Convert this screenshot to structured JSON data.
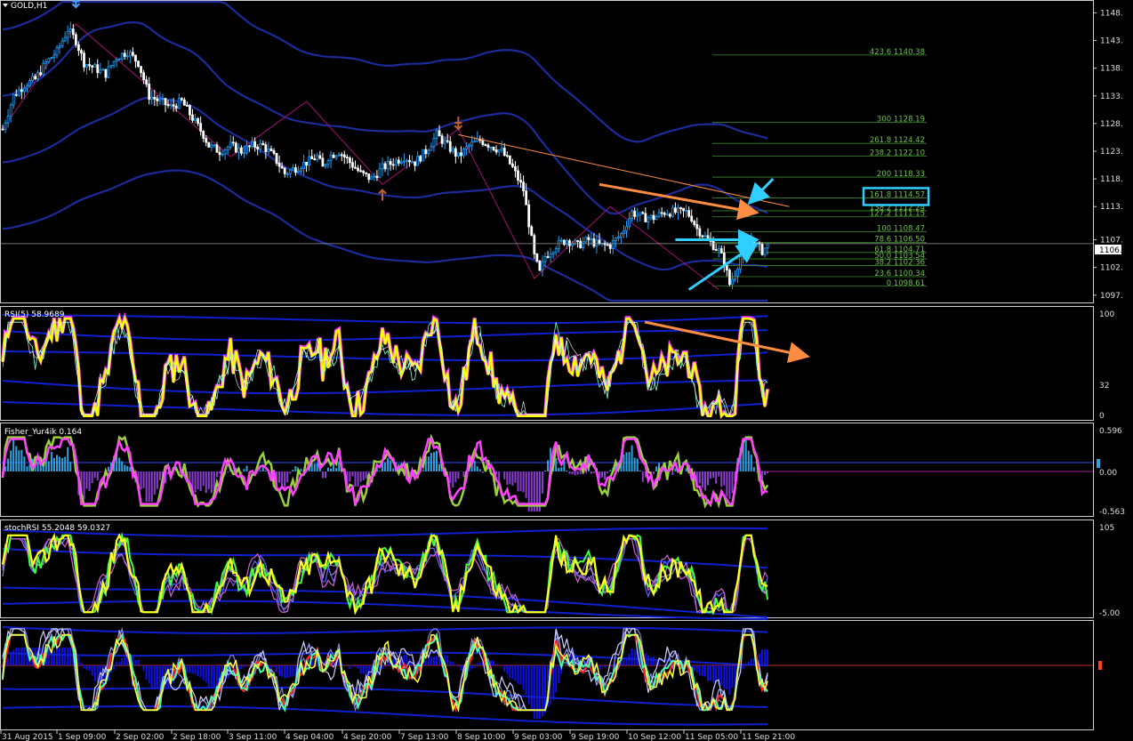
{
  "window": {
    "symbol_title": "GOLD,H1",
    "menu_icon": "triangle-down-icon"
  },
  "colors": {
    "background": "#000000",
    "bull": "#1ea0ff",
    "bear": "#ffffff",
    "band": "#1c2a9a",
    "fib": "#3a8c2a",
    "fib_text": "#6fbf4f",
    "orange": "#ff8c40",
    "cyan": "#2fd0ff",
    "zigzag": "#a01070",
    "rsi": "#ffff00",
    "rsi_shadow": "#ff40ff",
    "fisher_line": "#ff40ff",
    "fisher_line2": "#9bd03a",
    "fisher_up": "#2fa0e0",
    "fisher_dn": "#8a3fd0",
    "stoch_yellow": "#ffff20",
    "stoch_green": "#40ff40"
  },
  "price_axis": {
    "ticks": [
      "1148.",
      "1143.",
      "1138.",
      "1133.",
      "1128.",
      "1123.",
      "1118.",
      "1113.",
      "1107.",
      "1102.",
      "1097."
    ],
    "current_price": "1106."
  },
  "fib_levels": [
    {
      "label": "423.6 1140.38",
      "value": 1140.38
    },
    {
      "label": "300 1128.19",
      "value": 1128.19
    },
    {
      "label": "261.8 1124.42",
      "value": 1124.42
    },
    {
      "label": "238.2 1122.10",
      "value": 1122.1
    },
    {
      "label": "200 1118.33",
      "value": 1118.33
    },
    {
      "label": "161.8 1114.57",
      "value": 1114.57
    },
    {
      "label": "138.2 1112.24",
      "value": 1112.24
    },
    {
      "label": "127.2 1111.15",
      "value": 1111.15
    },
    {
      "label": "100 1108.47",
      "value": 1108.47
    },
    {
      "label": "78.6 1106.50",
      "value": 1106.5
    },
    {
      "label": "61.8 1104.71",
      "value": 1104.71
    },
    {
      "label": "50.0 1103.54",
      "value": 1103.54
    },
    {
      "label": "38.2 1102.36",
      "value": 1102.36
    },
    {
      "label": "23.6 1100.34",
      "value": 1100.34
    },
    {
      "label": "0 1098.61",
      "value": 1098.61
    }
  ],
  "panels": {
    "rsi": {
      "title": "RSI(5) 58.9689",
      "ticks": [
        "100",
        "32",
        "0"
      ]
    },
    "fisher": {
      "title": "Fisher_Yur4ik 0.164",
      "ticks": [
        "0.596",
        "0.00",
        "-0.563"
      ]
    },
    "stoch": {
      "title": "stochRSI 55.2048 59.0327",
      "ticks": [
        "105",
        "-5.00"
      ]
    },
    "osc": {
      "title": "",
      "ticks": []
    }
  },
  "time_axis": {
    "labels": [
      "31 Aug 2015",
      "1 Sep 09:00",
      "2 Sep 02:00",
      "2 Sep 18:00",
      "3 Sep 11:00",
      "4 Sep 04:00",
      "4 Sep 20:00",
      "7 Sep 13:00",
      "8 Sep 10:00",
      "9 Sep 03:00",
      "9 Sep 19:00",
      "10 Sep 12:00",
      "11 Sep 05:00",
      "11 Sep 21:00"
    ]
  },
  "chart_data": {
    "type": "candlestick",
    "symbol": "GOLD",
    "timeframe": "H1",
    "price_range": [
      1096,
      1150
    ],
    "close_path": [
      [
        0,
        1127
      ],
      [
        4,
        1133
      ],
      [
        8,
        1135
      ],
      [
        12,
        1136
      ],
      [
        16,
        1139
      ],
      [
        20,
        1141
      ],
      [
        24,
        1145
      ],
      [
        27,
        1143
      ],
      [
        30,
        1139
      ],
      [
        34,
        1138
      ],
      [
        38,
        1137
      ],
      [
        42,
        1140
      ],
      [
        46,
        1141
      ],
      [
        50,
        1139
      ],
      [
        54,
        1133
      ],
      [
        58,
        1132
      ],
      [
        62,
        1131
      ],
      [
        66,
        1132
      ],
      [
        70,
        1129
      ],
      [
        74,
        1126
      ],
      [
        76,
        1124
      ],
      [
        80,
        1123
      ],
      [
        84,
        1124
      ],
      [
        88,
        1123
      ],
      [
        92,
        1124
      ],
      [
        96,
        1124
      ],
      [
        100,
        1122
      ],
      [
        104,
        1119
      ],
      [
        108,
        1120
      ],
      [
        112,
        1121
      ],
      [
        116,
        1122
      ],
      [
        118,
        1120
      ],
      [
        120,
        1122
      ],
      [
        124,
        1123
      ],
      [
        128,
        1121
      ],
      [
        132,
        1119
      ],
      [
        136,
        1118
      ],
      [
        140,
        1120
      ],
      [
        144,
        1121
      ],
      [
        148,
        1122
      ],
      [
        152,
        1121
      ],
      [
        156,
        1123
      ],
      [
        160,
        1126
      ],
      [
        164,
        1124
      ],
      [
        168,
        1122
      ],
      [
        172,
        1124
      ],
      [
        176,
        1125
      ],
      [
        180,
        1124
      ],
      [
        184,
        1123
      ],
      [
        188,
        1120
      ],
      [
        192,
        1116
      ],
      [
        194,
        1110
      ],
      [
        196,
        1104
      ],
      [
        198,
        1101
      ],
      [
        200,
        1104
      ],
      [
        204,
        1106
      ],
      [
        208,
        1107
      ],
      [
        212,
        1106
      ],
      [
        216,
        1107
      ],
      [
        220,
        1106
      ],
      [
        224,
        1106
      ],
      [
        228,
        1108
      ],
      [
        232,
        1112
      ],
      [
        236,
        1111
      ],
      [
        240,
        1111
      ],
      [
        244,
        1112
      ],
      [
        248,
        1112
      ],
      [
        252,
        1112
      ],
      [
        254,
        1111
      ],
      [
        256,
        1109
      ],
      [
        260,
        1107
      ],
      [
        264,
        1105
      ],
      [
        266,
        1103
      ],
      [
        268,
        1099
      ],
      [
        270,
        1101
      ],
      [
        272,
        1104
      ],
      [
        274,
        1106
      ],
      [
        276,
        1107
      ],
      [
        278,
        1106
      ],
      [
        280,
        1105
      ],
      [
        282,
        1106
      ]
    ],
    "bands": [
      {
        "name": "upper-outer",
        "values": [
          [
            180,
            1152
          ],
          [
            230,
            1146
          ],
          [
            280,
            1145
          ]
        ]
      }
    ],
    "zigzag": [
      [
        0,
        1127
      ],
      [
        27,
        1146
      ],
      [
        84,
        1122
      ],
      [
        112,
        1132
      ],
      [
        140,
        1117
      ],
      [
        168,
        1127
      ],
      [
        196,
        1100
      ],
      [
        224,
        1113
      ],
      [
        264,
        1098
      ]
    ],
    "annotations": [
      {
        "type": "down-arrow",
        "bar": 27,
        "price": 1149,
        "color": "#4aa0ff"
      },
      {
        "type": "up-arrow",
        "bar": 140,
        "price": 1116,
        "color": "#c06030"
      },
      {
        "type": "down-arrow",
        "bar": 168,
        "price": 1127,
        "color": "#c06030"
      },
      {
        "type": "trendline",
        "from": [
          168,
          1126
        ],
        "to": [
          290,
          1113
        ],
        "color": "#ff8c40"
      },
      {
        "type": "arrow",
        "from": [
          220,
          1117
        ],
        "to": [
          277,
          1112
        ],
        "color": "#ff8c40"
      },
      {
        "type": "arrow",
        "from": [
          248,
          1107
        ],
        "to": [
          277,
          1107
        ],
        "color": "#2fd0ff"
      },
      {
        "type": "arrow",
        "from": [
          253,
          1098
        ],
        "to": [
          277,
          1106
        ],
        "color": "#2fd0ff"
      },
      {
        "type": "arrow",
        "from": [
          284,
          1118
        ],
        "to": [
          276,
          1114
        ],
        "color": "#2fd0ff"
      }
    ],
    "highlight_box": {
      "label": "161.8 1114.57"
    }
  }
}
